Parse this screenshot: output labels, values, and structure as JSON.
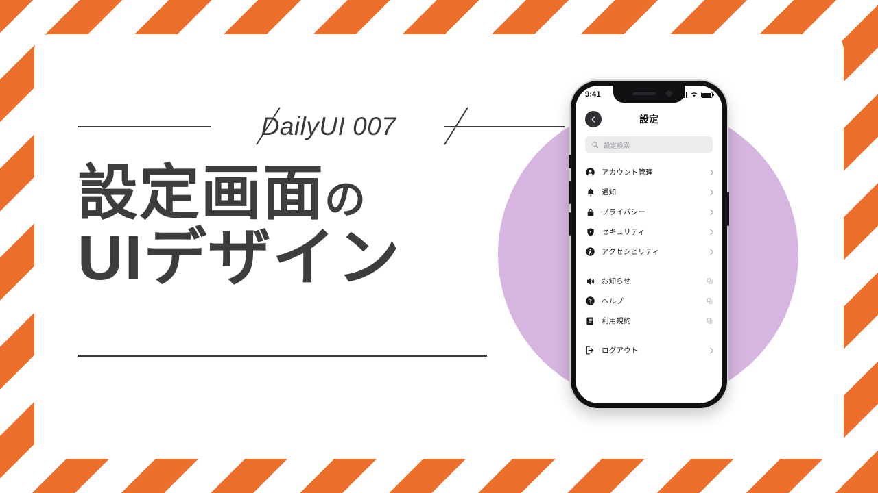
{
  "theme": {
    "stripe_color": "#EC6F2B",
    "card_bg": "#FFFFFF",
    "circle_color": "#D6B6E0",
    "text_dark": "#3D3D3D"
  },
  "left": {
    "eyebrow": "DailyUI 007",
    "headline_line1_main": "設定画面",
    "headline_line1_suffix": "の",
    "headline_line2": "UIデザイン"
  },
  "phone": {
    "status": {
      "time": "9:41",
      "signal_icon": "cellular-bars-icon",
      "wifi_icon": "wifi-icon",
      "battery_icon": "battery-icon"
    },
    "nav": {
      "back_icon": "chevron-left-icon",
      "title": "設定"
    },
    "search": {
      "icon": "search-icon",
      "placeholder": "設定検索",
      "value": ""
    },
    "groups": [
      {
        "items": [
          {
            "icon": "user-circle-icon",
            "label": "アカウント管理",
            "tail": "chevron-right-icon"
          },
          {
            "icon": "bell-icon",
            "label": "通知",
            "tail": "chevron-right-icon"
          },
          {
            "icon": "lock-icon",
            "label": "プライバシー",
            "tail": "chevron-right-icon"
          },
          {
            "icon": "shield-icon",
            "label": "セキュリティ",
            "tail": "chevron-right-icon"
          },
          {
            "icon": "accessibility-icon",
            "label": "アクセシビリティ",
            "tail": "chevron-right-icon"
          }
        ]
      },
      {
        "items": [
          {
            "icon": "speaker-icon",
            "label": "お知らせ",
            "tail": "external-link-icon"
          },
          {
            "icon": "question-circle-icon",
            "label": "ヘルプ",
            "tail": "external-link-icon"
          },
          {
            "icon": "document-icon",
            "label": "利用規約",
            "tail": "external-link-icon"
          }
        ]
      },
      {
        "items": [
          {
            "icon": "logout-icon",
            "label": "ログアウト",
            "tail": "chevron-right-icon"
          }
        ]
      }
    ]
  }
}
